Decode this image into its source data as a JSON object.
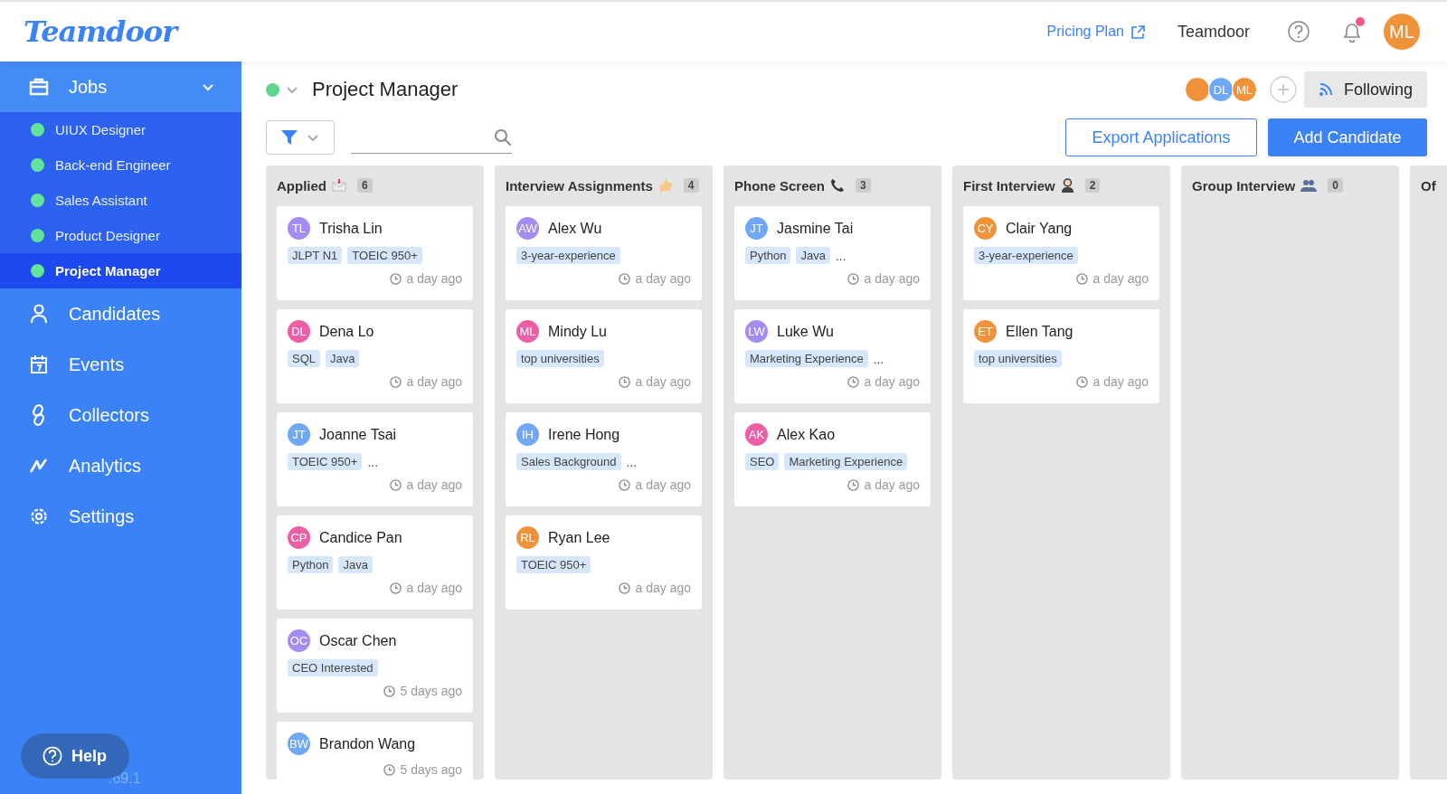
{
  "header": {
    "logo": "Teamdoor",
    "pricing_link": "Pricing Plan",
    "workspace": "Teamdoor",
    "notification_unread": true,
    "user_initials": "ML"
  },
  "sidebar": {
    "items": [
      {
        "label": "Jobs",
        "kind": "jobs",
        "expanded": true,
        "children": [
          {
            "label": "UIUX Designer",
            "color": "#62e29a",
            "selected": false
          },
          {
            "label": "Back-end Engineer",
            "color": "#62e29a",
            "selected": false
          },
          {
            "label": "Sales Assistant",
            "color": "#62e29a",
            "selected": false
          },
          {
            "label": "Product Designer",
            "color": "#62e29a",
            "selected": false
          },
          {
            "label": "Project Manager",
            "color": "#62e29a",
            "selected": true
          }
        ]
      },
      {
        "label": "Candidates",
        "kind": "candidates"
      },
      {
        "label": "Events",
        "kind": "events"
      },
      {
        "label": "Collectors",
        "kind": "collectors"
      },
      {
        "label": "Analytics",
        "kind": "analytics"
      },
      {
        "label": "Settings",
        "kind": "settings"
      }
    ],
    "help": "Help",
    "version": ".69.1"
  },
  "job": {
    "title": "Project Manager",
    "color": "#5ed68e",
    "followers": [
      {
        "color": "#f0923a"
      },
      {
        "initials": "DL",
        "color": "#6ea8f7"
      },
      {
        "initials": "ML",
        "color": "#f0923a"
      }
    ],
    "follow_button": "Following",
    "export_button": "Export Applications",
    "add_button": "Add Candidate"
  },
  "columns": [
    {
      "title": "Applied",
      "kind": "envelope",
      "count": "6",
      "cards": [
        {
          "initials": "TL",
          "name": "Trisha Lin",
          "color": "#a48cf0",
          "tags": [
            "JLPT N1",
            "TOEIC 950+"
          ],
          "time": "a day ago"
        },
        {
          "initials": "DL",
          "name": "Dena Lo",
          "color": "#ec5fa4",
          "tags": [
            "SQL",
            "Java"
          ],
          "time": "a day ago"
        },
        {
          "initials": "JT",
          "name": "Joanne Tsai",
          "color": "#70a8f5",
          "tags": [
            "TOEIC 950+"
          ],
          "more": "...",
          "time": "a day ago"
        },
        {
          "initials": "CP",
          "name": "Candice Pan",
          "color": "#ec5fa4",
          "tags": [
            "Python",
            "Java"
          ],
          "time": "a day ago"
        },
        {
          "initials": "OC",
          "name": "Oscar Chen",
          "color": "#a48cf0",
          "tags": [
            "CEO Interested"
          ],
          "time": "5 days ago"
        },
        {
          "initials": "BW",
          "name": "Brandon Wang",
          "color": "#70a8f5",
          "time": "5 days ago"
        }
      ]
    },
    {
      "title": "Interview Assignments",
      "kind": "thumb",
      "count": "4",
      "cards": [
        {
          "initials": "AW",
          "name": "Alex Wu",
          "color": "#a48cf0",
          "tags": [
            "3-year-experience"
          ],
          "time": "a day ago"
        },
        {
          "initials": "ML",
          "name": "Mindy Lu",
          "color": "#ec5fa4",
          "tags": [
            "top universities"
          ],
          "time": "a day ago"
        },
        {
          "initials": "IH",
          "name": "Irene Hong",
          "color": "#70a8f5",
          "tags": [
            "Sales Background"
          ],
          "more": "...",
          "time": "a day ago"
        },
        {
          "initials": "RL",
          "name": "Ryan Lee",
          "color": "#f0923a",
          "tags": [
            "TOEIC 950+"
          ],
          "time": "a day ago"
        }
      ]
    },
    {
      "title": "Phone Screen",
      "kind": "phone",
      "count": "3",
      "cards": [
        {
          "initials": "JT",
          "name": "Jasmine Tai",
          "color": "#70a8f5",
          "tags": [
            "Python",
            "Java"
          ],
          "more": "...",
          "time": "a day ago"
        },
        {
          "initials": "LW",
          "name": "Luke Wu",
          "color": "#a48cf0",
          "tags": [
            "Marketing Experience"
          ],
          "more": "...",
          "time": "a day ago"
        },
        {
          "initials": "AK",
          "name": "Alex Kao",
          "color": "#ec5fa4",
          "tags": [
            "SEO",
            "Marketing Experience"
          ],
          "time": "a day ago"
        }
      ]
    },
    {
      "title": "First Interview",
      "kind": "person",
      "count": "2",
      "cards": [
        {
          "initials": "CY",
          "name": "Clair Yang",
          "color": "#f0923a",
          "tags": [
            "3-year-experience"
          ],
          "time": "a day ago"
        },
        {
          "initials": "ET",
          "name": "Ellen Tang",
          "color": "#f0923a",
          "tags": [
            "top universities"
          ],
          "time": "a day ago"
        }
      ]
    },
    {
      "title": "Group Interview",
      "kind": "people",
      "count": "0"
    },
    {
      "title": "Of"
    }
  ]
}
